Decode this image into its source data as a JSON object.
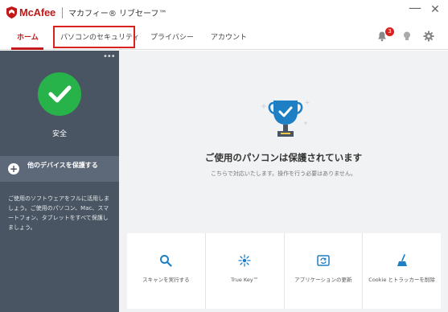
{
  "titlebar": {
    "brand": "McAfee",
    "product": "マカフィー® リブセーフ™",
    "minimize_glyph": "—",
    "close_glyph": "✕"
  },
  "nav": {
    "tabs": [
      {
        "label": "ホーム",
        "active": true
      },
      {
        "label": "パソコンのセキュリティ",
        "active": false
      },
      {
        "label": "プライバシー",
        "active": false
      },
      {
        "label": "アカウント",
        "active": false
      }
    ],
    "notification_count": "3",
    "icons": [
      "bell-icon",
      "lightbulb-icon",
      "gear-icon"
    ]
  },
  "sidebar": {
    "menu_glyph": "•••",
    "status_label": "安全",
    "protect_label": "他のデバイスを保護する",
    "description": "ご使用のソフトウェアをフルに活用しましょう。ご使用のパソコン、Mac、スマートフォン、タブレットをすべて保護しましょう。"
  },
  "main": {
    "headline": "ご使用のパソコンは保護されています",
    "subline": "こちらで対応いたします。操作を行う必要はありません。",
    "cards": [
      {
        "label": "スキャンを実行する",
        "icon": "search-icon"
      },
      {
        "label": "True Key™",
        "icon": "true-key-icon"
      },
      {
        "label": "アプリケーションの更新",
        "icon": "update-icon"
      },
      {
        "label": "Cookie とトラッカーを削除",
        "icon": "broom-icon"
      }
    ]
  },
  "colors": {
    "brand_red": "#c01818",
    "sidebar_bg": "#4a5563",
    "safe_green": "#27b24a",
    "accent_blue": "#1f7fc4"
  }
}
